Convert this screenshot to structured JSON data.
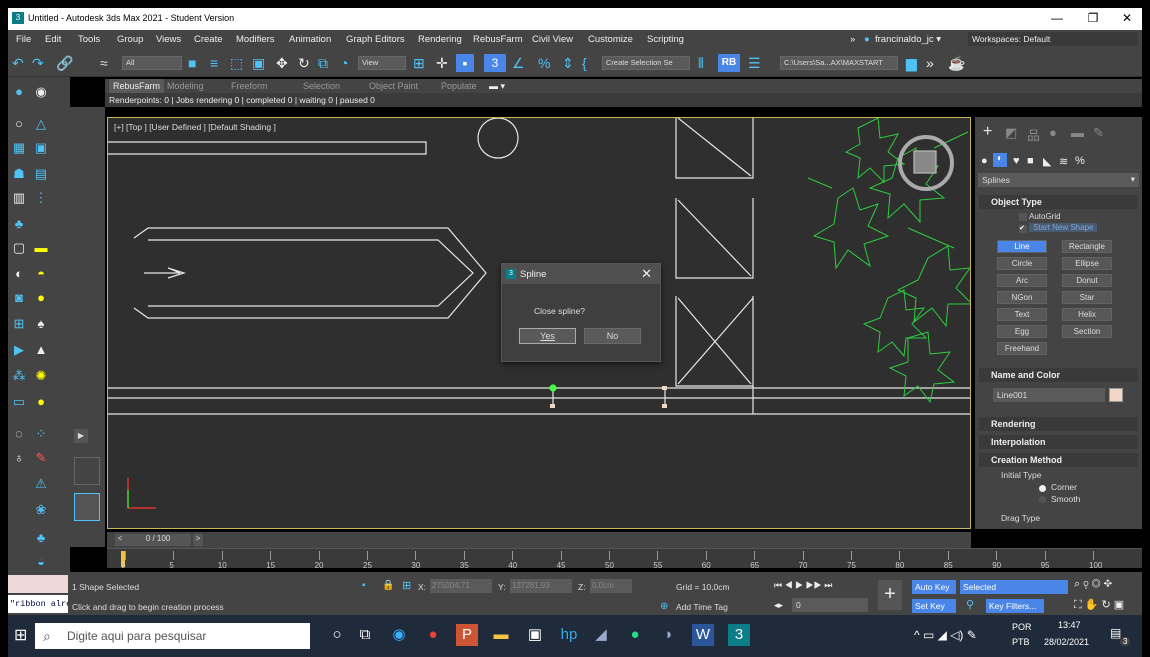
{
  "title_bar": {
    "title": "Untitled - Autodesk 3ds Max 2021 - Student Version",
    "minimize": "—",
    "restore": "❐",
    "close": "✕"
  },
  "menu": [
    "File",
    "Edit",
    "Tools",
    "Group",
    "Views",
    "Create",
    "Modifiers",
    "Animation",
    "Graph Editors",
    "Rendering",
    "RebusFarm",
    "Civil View",
    "Customize",
    "Scripting"
  ],
  "menu_right": {
    "more": "»",
    "user": "francinaldo_jc ▾",
    "workspaces": "Workspaces: Default"
  },
  "toolbar": {
    "filter": "All",
    "view": "View",
    "selection_set": "Create Selection Se",
    "rb": "RB",
    "path": "C:\\Users\\Sa...AX\\MAXSTART"
  },
  "ribbon": {
    "tabs": [
      "RebusFarm",
      "Modeling",
      "Freeform",
      "Selection",
      "Object Paint",
      "Populate"
    ],
    "status": "Renderpoints: 0 | Jobs rendering 0 | completed 0 | waiting 0 | paused 0"
  },
  "viewport": {
    "label": "[+] [Top ] [User Defined ] [Default Shading ]"
  },
  "dialog": {
    "title": "Spline",
    "message": "Close spline?",
    "yes": "Yes",
    "no": "No",
    "close": "✕"
  },
  "command_panel": {
    "category": "Splines",
    "object_type_header": "Object Type",
    "autogrid": "AutoGrid",
    "start_new_shape": "Start New Shape",
    "buttons": [
      "Line",
      "Rectangle",
      "Circle",
      "Ellipse",
      "Arc",
      "Donut",
      "NGon",
      "Star",
      "Text",
      "Helix",
      "Egg",
      "Section",
      "Freehand"
    ],
    "name_color_header": "Name and Color",
    "object_name": "Line001",
    "object_color": "#f2d7c4",
    "rendering_header": "Rendering",
    "interpolation_header": "Interpolation",
    "creation_header": "Creation Method",
    "initial_type": "Initial Type",
    "corner": "Corner",
    "smooth": "Smooth",
    "drag_type": "Drag Type"
  },
  "timeline": {
    "slider": "0 / 100",
    "prev": "<",
    "next": ">",
    "ticks": [
      "0",
      "5",
      "10",
      "15",
      "20",
      "25",
      "30",
      "35",
      "40",
      "45",
      "50",
      "55",
      "60",
      "65",
      "70",
      "75",
      "80",
      "85",
      "90",
      "95",
      "100"
    ]
  },
  "status": {
    "selected": "1 Shape Selected",
    "prompt": "Click and drag to begin creation process",
    "maxscript": "\"ribbon alre",
    "x_label": "X:",
    "x_value": "275004,71",
    "y_label": "Y:",
    "y_value": "127281,93",
    "z_label": "Z:",
    "z_value": "0,0cm",
    "grid": "Grid = 10,0cm",
    "add_time_tag": "Add Time Tag",
    "frame": "0",
    "auto_key": "Auto Key",
    "selected_dropdown": "Selected",
    "set_key": "Set Key",
    "key_filters": "Key Filters..."
  },
  "taskbar": {
    "search_placeholder": "Digite aqui para pesquisar",
    "lang_top": "POR",
    "lang_bottom": "PTB",
    "time": "13:47",
    "date": "28/02/2021",
    "notifications": "3"
  },
  "colors": {
    "accent": "#4fc3f7",
    "active_button": "#4a86e8",
    "spline_green": "#2ecc40",
    "viewport_border": "#c9b458"
  }
}
